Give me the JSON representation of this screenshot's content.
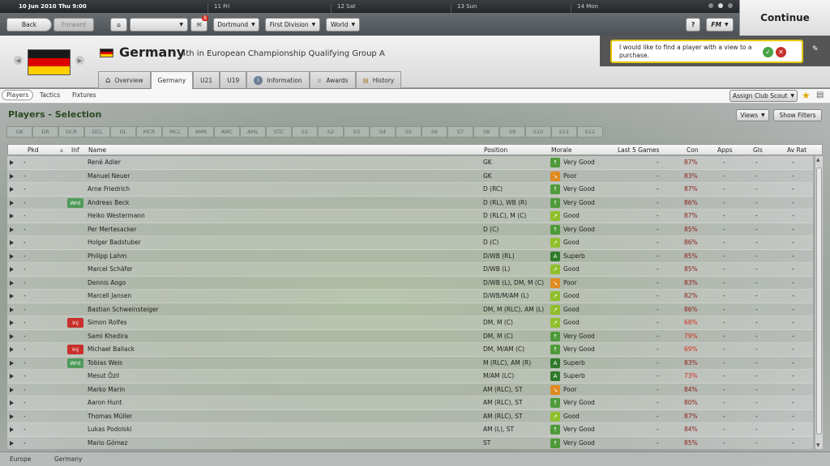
{
  "topbar": {
    "date": "10 Jun 2010 Thu 9:00",
    "days": [
      "11 Fri",
      "12 Sat",
      "13 Sun",
      "14 Mon"
    ],
    "continue_label": "Continue"
  },
  "navbar": {
    "back": "Back",
    "forward": "Forward",
    "inbox_count": "8",
    "club": "Dortmund",
    "division": "First Division",
    "world": "World",
    "help": "?",
    "fm": "FM"
  },
  "header": {
    "nation": "Germany",
    "subtitle": "4th in European Championship Qualifying Group A",
    "flag_colors": [
      "#1a1a1a",
      "#dd0000",
      "#ffce00"
    ],
    "tabs": [
      "Overview",
      "Germany",
      "U21",
      "U19",
      "Information",
      "Awards",
      "History"
    ]
  },
  "notice": {
    "text": "I would like to find a player with a view to a purchase."
  },
  "subtabs": [
    "Players",
    "Tactics",
    "Fixtures"
  ],
  "assign_scout": "Assign Club Scout",
  "section_title": "Players - Selection",
  "views_label": "Views",
  "show_filters": "Show Filters",
  "positions": [
    "GK",
    "DR",
    "DCR",
    "DCL",
    "DL",
    "MCR",
    "MCL",
    "AMR",
    "AMC",
    "AML",
    "STC",
    "S1",
    "S2",
    "S3",
    "S4",
    "S5",
    "S6",
    "S7",
    "S8",
    "S9",
    "S10",
    "S11",
    "S12"
  ],
  "columns": [
    "Pkd",
    "Inf",
    "Name",
    "Position",
    "Morale",
    "Last 5 Games",
    "Con",
    "Apps",
    "Gls",
    "Av Rat"
  ],
  "players": [
    {
      "pkd": "-",
      "inf": "",
      "name": "René Adler",
      "pos": "GK",
      "morale": "Very Good",
      "mclass": "vg",
      "last5": "-",
      "con": "87%",
      "apps": "-",
      "gls": "-",
      "rat": "-"
    },
    {
      "pkd": "-",
      "inf": "",
      "name": "Manuel Neuer",
      "pos": "GK",
      "morale": "Poor",
      "mclass": "poor",
      "last5": "-",
      "con": "83%",
      "apps": "-",
      "gls": "-",
      "rat": "-"
    },
    {
      "pkd": "-",
      "inf": "",
      "name": "Arne Friedrich",
      "pos": "D (RC)",
      "morale": "Very Good",
      "mclass": "vg",
      "last5": "-",
      "con": "87%",
      "apps": "-",
      "gls": "-",
      "rat": "-"
    },
    {
      "pkd": "-",
      "inf": "Wnt",
      "name": "Andreas Beck",
      "pos": "D (RL), WB (R)",
      "morale": "Very Good",
      "mclass": "vg",
      "last5": "-",
      "con": "86%",
      "apps": "-",
      "gls": "-",
      "rat": "-"
    },
    {
      "pkd": "-",
      "inf": "",
      "name": "Heiko Westermann",
      "pos": "D (RLC), M (C)",
      "morale": "Good",
      "mclass": "good",
      "last5": "-",
      "con": "87%",
      "apps": "-",
      "gls": "-",
      "rat": "-"
    },
    {
      "pkd": "-",
      "inf": "",
      "name": "Per Mertesacker",
      "pos": "D (C)",
      "morale": "Very Good",
      "mclass": "vg",
      "last5": "-",
      "con": "85%",
      "apps": "-",
      "gls": "-",
      "rat": "-"
    },
    {
      "pkd": "-",
      "inf": "",
      "name": "Holger Badstuber",
      "pos": "D (C)",
      "morale": "Good",
      "mclass": "good",
      "last5": "-",
      "con": "86%",
      "apps": "-",
      "gls": "-",
      "rat": "-"
    },
    {
      "pkd": "-",
      "inf": "",
      "name": "Philipp Lahm",
      "pos": "D/WB (RL)",
      "morale": "Superb",
      "mclass": "sup",
      "last5": "-",
      "con": "85%",
      "apps": "-",
      "gls": "-",
      "rat": "-"
    },
    {
      "pkd": "-",
      "inf": "",
      "name": "Marcel Schäfer",
      "pos": "D/WB (L)",
      "morale": "Good",
      "mclass": "good",
      "last5": "-",
      "con": "85%",
      "apps": "-",
      "gls": "-",
      "rat": "-"
    },
    {
      "pkd": "-",
      "inf": "",
      "name": "Dennis Aogo",
      "pos": "D/WB (L), DM, M (C)",
      "morale": "Poor",
      "mclass": "poor",
      "last5": "-",
      "con": "83%",
      "apps": "-",
      "gls": "-",
      "rat": "-"
    },
    {
      "pkd": "-",
      "inf": "",
      "name": "Marcell Jansen",
      "pos": "D/WB/M/AM (L)",
      "morale": "Good",
      "mclass": "good",
      "last5": "-",
      "con": "82%",
      "apps": "-",
      "gls": "-",
      "rat": "-"
    },
    {
      "pkd": "-",
      "inf": "",
      "name": "Bastian Schweinsteiger",
      "pos": "DM, M (RLC), AM (L)",
      "morale": "Good",
      "mclass": "good",
      "last5": "-",
      "con": "86%",
      "apps": "-",
      "gls": "-",
      "rat": "-"
    },
    {
      "pkd": "-",
      "inf": "Inj",
      "name": "Simon Rolfes",
      "pos": "DM, M (C)",
      "morale": "Good",
      "mclass": "good",
      "last5": "-",
      "con": "68%",
      "apps": "-",
      "gls": "-",
      "rat": "-"
    },
    {
      "pkd": "-",
      "inf": "",
      "name": "Sami Khedira",
      "pos": "DM, M (C)",
      "morale": "Very Good",
      "mclass": "vg",
      "last5": "-",
      "con": "79%",
      "apps": "-",
      "gls": "-",
      "rat": "-"
    },
    {
      "pkd": "-",
      "inf": "Inj",
      "name": "Michael Ballack",
      "pos": "DM, M/AM (C)",
      "morale": "Very Good",
      "mclass": "vg",
      "last5": "-",
      "con": "69%",
      "apps": "-",
      "gls": "-",
      "rat": "-"
    },
    {
      "pkd": "-",
      "inf": "Wnt",
      "name": "Tobias Weis",
      "pos": "M (RLC), AM (R)",
      "morale": "Superb",
      "mclass": "sup",
      "last5": "-",
      "con": "83%",
      "apps": "-",
      "gls": "-",
      "rat": "-"
    },
    {
      "pkd": "-",
      "inf": "",
      "name": "Mesut Özil",
      "pos": "M/AM (LC)",
      "morale": "Superb",
      "mclass": "sup",
      "last5": "-",
      "con": "73%",
      "apps": "-",
      "gls": "-",
      "rat": "-"
    },
    {
      "pkd": "-",
      "inf": "",
      "name": "Marko Marin",
      "pos": "AM (RLC), ST",
      "morale": "Poor",
      "mclass": "poor",
      "last5": "-",
      "con": "84%",
      "apps": "-",
      "gls": "-",
      "rat": "-"
    },
    {
      "pkd": "-",
      "inf": "",
      "name": "Aaron Hunt",
      "pos": "AM (RLC), ST",
      "morale": "Very Good",
      "mclass": "vg",
      "last5": "-",
      "con": "80%",
      "apps": "-",
      "gls": "-",
      "rat": "-"
    },
    {
      "pkd": "-",
      "inf": "",
      "name": "Thomas Müller",
      "pos": "AM (RLC), ST",
      "morale": "Good",
      "mclass": "good",
      "last5": "-",
      "con": "87%",
      "apps": "-",
      "gls": "-",
      "rat": "-"
    },
    {
      "pkd": "-",
      "inf": "",
      "name": "Lukas Podolski",
      "pos": "AM (L), ST",
      "morale": "Very Good",
      "mclass": "vg",
      "last5": "-",
      "con": "84%",
      "apps": "-",
      "gls": "-",
      "rat": "-"
    },
    {
      "pkd": "-",
      "inf": "",
      "name": "Mario Gómez",
      "pos": "ST",
      "morale": "Very Good",
      "mclass": "vg",
      "last5": "-",
      "con": "85%",
      "apps": "-",
      "gls": "-",
      "rat": "-"
    }
  ],
  "footer": [
    "Europe",
    "Germany"
  ],
  "colors": {
    "con_good": "#8b1d17",
    "con_low": "#d42a1e",
    "morale_vg": "#4e9a3a",
    "morale_good": "#8fbf2b",
    "morale_poor": "#e08a22",
    "morale_superb": "#2e7a2a",
    "badge_wnt": "#4f9a5a",
    "badge_inj": "#c8302c"
  }
}
